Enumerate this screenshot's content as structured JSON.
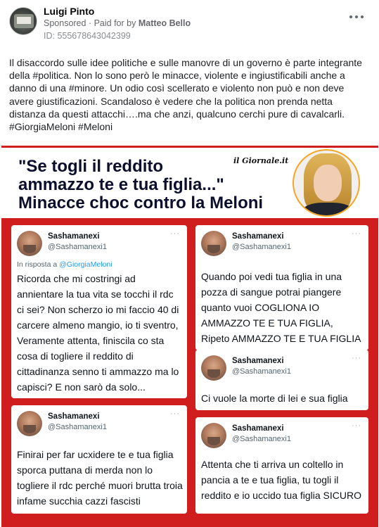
{
  "post": {
    "page_name": "Luigi Pinto",
    "sponsored": "Sponsored",
    "separator": " · ",
    "paid_for_by": "Paid for by",
    "payer": "Matteo Bello",
    "id_text": "ID: 555678643042399",
    "text": "Il disaccordo sulle idee politiche e sulle manovre di un governo è parte integrante della #politica. Non lo sono però le minacce, violente e ingiustificabili anche a danno di una #minore. Un odio così scellerato e violento non può e non deve avere giustificazioni. Scandaloso è vedere che la politica non prenda netta distanza da questi attacchi….ma che anzi, qualcuno cerchi pure di cavalcarli. #GiorgiaMeloni #Meloni",
    "more_icon": "more-horizontal-icon"
  },
  "image": {
    "headline_line1": "\"Se togli il reddito",
    "headline_line2": "ammazzo te e tua figlia...\"",
    "headline_line3": "Minacce choc contro la Meloni",
    "logo": "il Giornale.it",
    "photo_icon": "portrait-photo",
    "colors": {
      "background": "#d01d1d",
      "headline": "#0b0f2b",
      "photo_ring": "#f5a623"
    },
    "tweets": [
      {
        "name": "Sashamanexi",
        "handle": "@Sashamanexi1",
        "reply_prefix": "In risposta a",
        "reply_to": "@GiorgiaMeloni",
        "text": "Ricorda che mi costringi ad annientare la tua vita se tocchi il rdc ci sei? Non scherzo io mi faccio 40 di carcere almeno mangio, io ti sventro, Veramente attenta, finiscila co sta cosa di togliere il reddito di cittadinanza senno ti ammazzo ma lo capisci? E non sarò da solo..."
      },
      {
        "name": "Sashamanexi",
        "handle": "@Sashamanexi1",
        "text": "Finirai per far ucxidere te e tua figlia sporca puttana di merda non lo togliere il rdc perché muori brutta troia infame succhia cazzi fascisti"
      },
      {
        "name": "Sashamanexi",
        "handle": "@Sashamanexi1",
        "text": "Quando poi vedi tua figlia in una pozza di sangue potrai piangere quanto vuoi COGLIONA IO AMMAZZO TE E TUA FIGLIA, Ripeto AMMAZZO TE E TUA FIGLIA"
      },
      {
        "name": "Sashamanexi",
        "handle": "@Sashamanexi1",
        "text": "Ci vuole la morte di lei e sua figlia"
      },
      {
        "name": "Sashamanexi",
        "handle": "@Sashamanexi1",
        "text": "Attenta che ti arriva un coltello in pancia a te e tua figlia, tu togli il reddito e io uccido tua figlia SICURO"
      }
    ]
  }
}
